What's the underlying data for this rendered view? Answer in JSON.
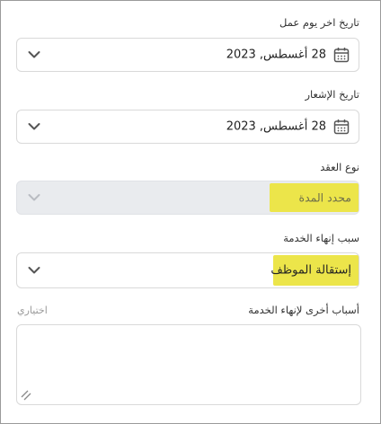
{
  "last_work_day": {
    "label": "تاريخ اخر يوم عمل",
    "value": "28 أغسطس, 2023"
  },
  "notice_date": {
    "label": "تاريخ الإشعار",
    "value": "28 أغسطس, 2023"
  },
  "contract_type": {
    "label": "نوع العقد",
    "value": "محدد المدة"
  },
  "termination_reason": {
    "label": "سبب إنهاء الخدمة",
    "value": "إستقالة الموظف"
  },
  "other_reasons": {
    "label": "أسباب أخرى لإنهاء الخدمة",
    "optional_label": "اختياري",
    "value": ""
  },
  "colors": {
    "highlight": "#ece54a",
    "disabled_bg": "#e9ebee",
    "border": "#d9d9d9"
  },
  "icons": {
    "calendar": "calendar-icon",
    "dropdown": "chevron-down-icon",
    "resize": "resize-grip-icon"
  }
}
